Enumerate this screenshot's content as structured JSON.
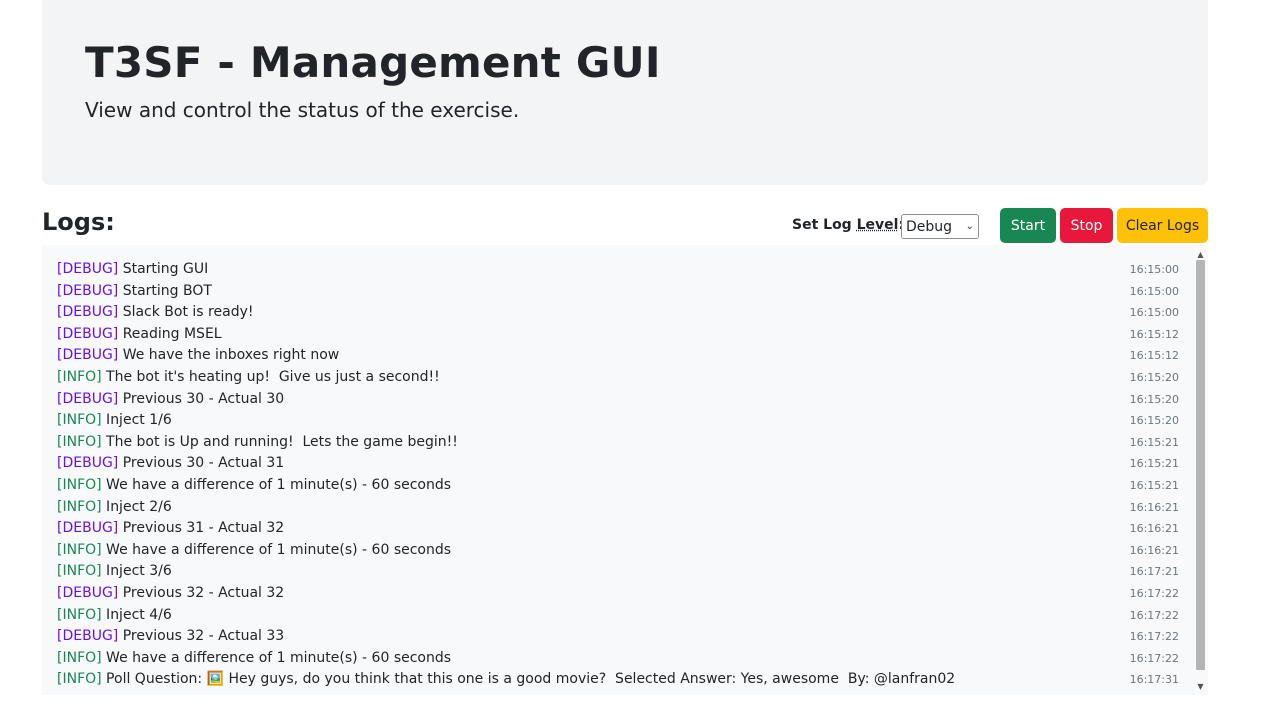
{
  "header": {
    "title": "T3SF - Management GUI",
    "subtitle": "View and control the status of the exercise."
  },
  "logs": {
    "title": "Logs:",
    "set_level_prefix": "Set Log ",
    "set_level_abbr": "Level",
    "set_level_suffix": ":",
    "level_value": "Debug"
  },
  "buttons": {
    "start": "Start",
    "stop": "Stop",
    "clear": "Clear Logs"
  },
  "colors": {
    "start": "#198754",
    "stop": "#e8173c",
    "clear": "#ffc107",
    "debug_tag": "#6610f2",
    "info_tag": "#198754"
  },
  "entries": [
    {
      "level": "DEBUG",
      "tag": "[DEBUG]",
      "message": " Starting GUI",
      "time": "16:15:00"
    },
    {
      "level": "DEBUG",
      "tag": "[DEBUG]",
      "message": " Starting BOT",
      "time": "16:15:00"
    },
    {
      "level": "DEBUG",
      "tag": "[DEBUG]",
      "message": " Slack Bot is ready!",
      "time": "16:15:00"
    },
    {
      "level": "DEBUG",
      "tag": "[DEBUG]",
      "message": " Reading MSEL",
      "time": "16:15:12"
    },
    {
      "level": "DEBUG",
      "tag": "[DEBUG]",
      "message": " We have the inboxes right now",
      "time": "16:15:12"
    },
    {
      "level": "INFO",
      "tag": "[INFO]",
      "message": " The bot it's heating up!  Give us just a second!!",
      "time": "16:15:20"
    },
    {
      "level": "DEBUG",
      "tag": "[DEBUG]",
      "message": " Previous 30 - Actual 30",
      "time": "16:15:20"
    },
    {
      "level": "INFO",
      "tag": "[INFO]",
      "message": " Inject 1/6",
      "time": "16:15:20"
    },
    {
      "level": "INFO",
      "tag": "[INFO]",
      "message": " The bot is Up and running!  Lets the game begin!!",
      "time": "16:15:21"
    },
    {
      "level": "DEBUG",
      "tag": "[DEBUG]",
      "message": " Previous 30 - Actual 31",
      "time": "16:15:21"
    },
    {
      "level": "INFO",
      "tag": "[INFO]",
      "message": " We have a difference of 1 minute(s) - 60 seconds",
      "time": "16:15:21"
    },
    {
      "level": "INFO",
      "tag": "[INFO]",
      "message": " Inject 2/6",
      "time": "16:16:21"
    },
    {
      "level": "DEBUG",
      "tag": "[DEBUG]",
      "message": " Previous 31 - Actual 32",
      "time": "16:16:21"
    },
    {
      "level": "INFO",
      "tag": "[INFO]",
      "message": " We have a difference of 1 minute(s) - 60 seconds",
      "time": "16:16:21"
    },
    {
      "level": "INFO",
      "tag": "[INFO]",
      "message": " Inject 3/6",
      "time": "16:17:21"
    },
    {
      "level": "DEBUG",
      "tag": "[DEBUG]",
      "message": " Previous 32 - Actual 32",
      "time": "16:17:22"
    },
    {
      "level": "INFO",
      "tag": "[INFO]",
      "message": " Inject 4/6",
      "time": "16:17:22"
    },
    {
      "level": "DEBUG",
      "tag": "[DEBUG]",
      "message": " Previous 32 - Actual 33",
      "time": "16:17:22"
    },
    {
      "level": "INFO",
      "tag": "[INFO]",
      "message": " We have a difference of 1 minute(s) - 60 seconds",
      "time": "16:17:22"
    },
    {
      "level": "INFO",
      "tag": "[INFO]",
      "message": " Poll Question: 🖼️ Hey guys, do you think that this one is a good movie?  Selected Answer: Yes, awesome  By: @lanfran02",
      "time": "16:17:31"
    }
  ]
}
